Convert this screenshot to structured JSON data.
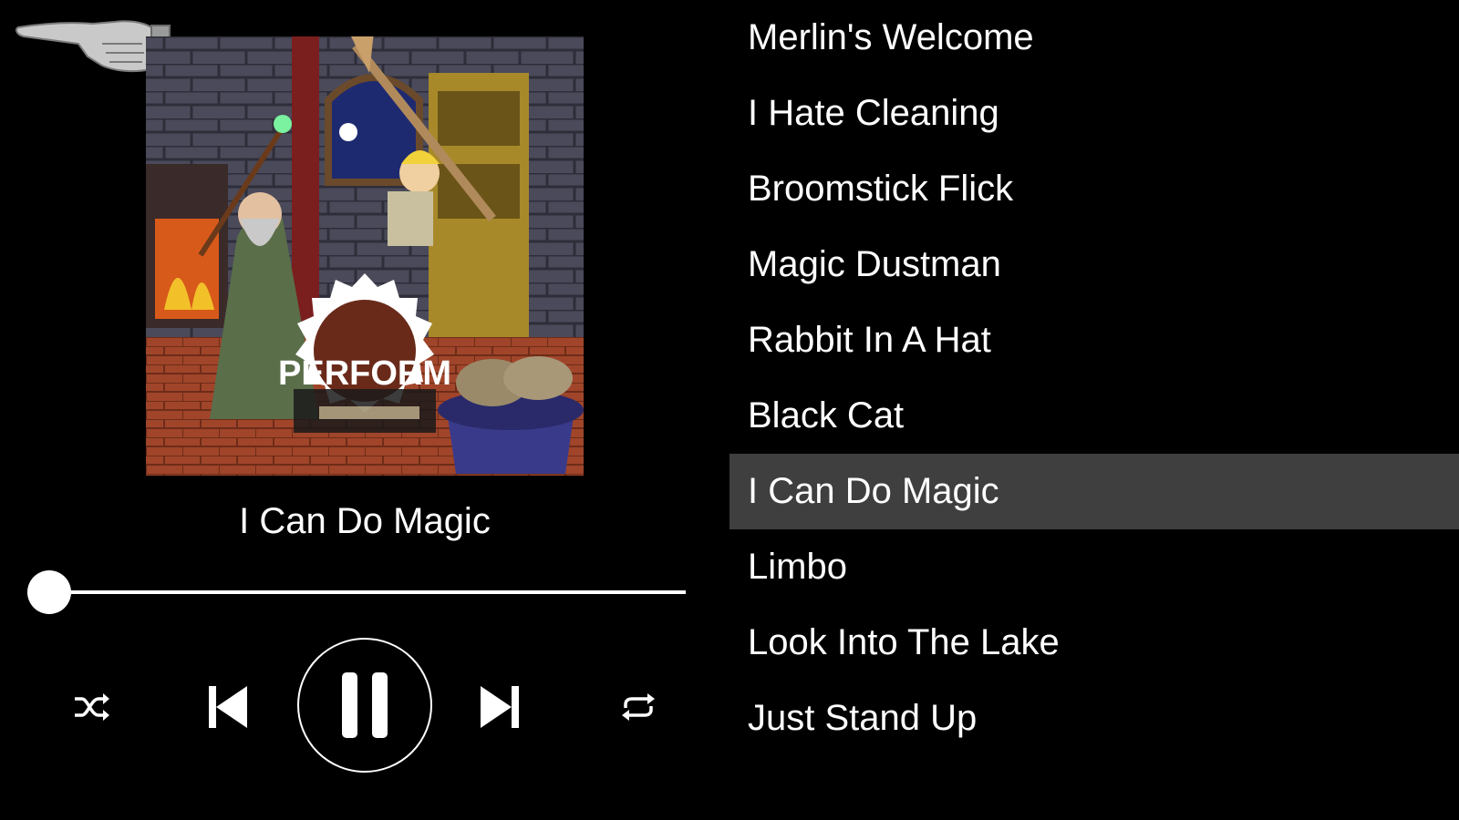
{
  "player": {
    "now_playing": "I Can Do Magic",
    "album_art_text": "PERFORM",
    "progress_fraction": 0.0,
    "controls": {
      "shuffle": "shuffle-icon",
      "previous": "skip-previous-icon",
      "play_pause": "pause-icon",
      "next": "skip-next-icon",
      "repeat": "repeat-icon"
    }
  },
  "playlist": {
    "active_index": 6,
    "tracks": [
      {
        "title": "Merlin's Welcome"
      },
      {
        "title": "I Hate Cleaning"
      },
      {
        "title": "Broomstick Flick"
      },
      {
        "title": "Magic Dustman"
      },
      {
        "title": "Rabbit In A Hat"
      },
      {
        "title": "Black Cat"
      },
      {
        "title": "I Can Do Magic"
      },
      {
        "title": "Limbo"
      },
      {
        "title": "Look Into The Lake"
      },
      {
        "title": "Just Stand Up"
      }
    ]
  },
  "colors": {
    "background": "#000000",
    "text": "#ffffff",
    "active_row": "#3f3f3f"
  }
}
